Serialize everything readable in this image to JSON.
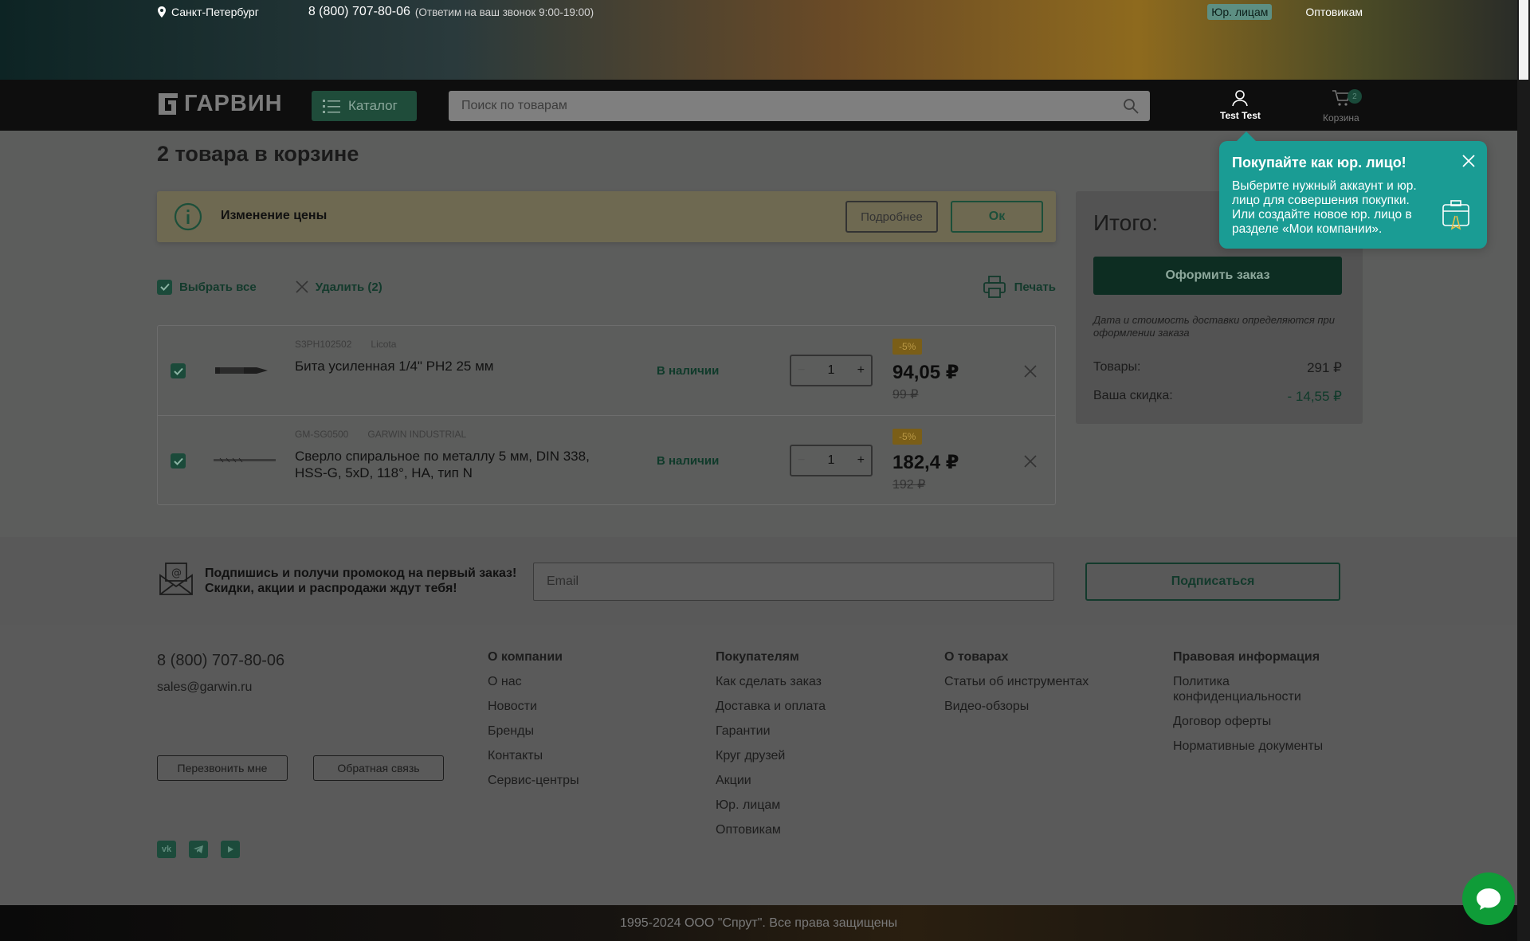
{
  "topbar": {
    "city": "Санкт-Петербург",
    "phone": "8 (800) 707-80-06",
    "phone_note": "(Ответим на ваш звонок 9:00-19:00)",
    "links": [
      "Юр. лицам",
      "Оптовикам"
    ]
  },
  "header": {
    "logo": "ГАРВИН",
    "catalog_label": "Каталог",
    "search_placeholder": "Поиск по товарам",
    "user_label": "Test Test",
    "cart_label": "Корзина",
    "cart_count": "2"
  },
  "cart": {
    "title": "2 товара в корзине",
    "notice": {
      "text": "Изменение цены",
      "more_label": "Подробнее",
      "ok_label": "Ок"
    },
    "select_all_label": "Выбрать все",
    "delete_label": "Удалить (2)",
    "print_label": "Печать",
    "items": [
      {
        "sku": "S3PH102502",
        "brand": "Licota",
        "name": "Бита усиленная 1/4\" PH2 25 мм",
        "stock": "В наличии",
        "qty": "1",
        "discount": "-5%",
        "price": "94,05 ₽",
        "old_price": "99 ₽"
      },
      {
        "sku": "GM-SG0500",
        "brand": "GARWIN INDUSTRIAL",
        "name": "Сверло спиральное по металлу 5 мм, DIN 338, HSS-G, 5xD, 118°, HA, тип N",
        "stock": "В наличии",
        "qty": "1",
        "discount": "-5%",
        "price": "182,4 ₽",
        "old_price": "192 ₽"
      }
    ]
  },
  "summary": {
    "title": "Итого:",
    "order_button": "Оформить заказ",
    "note": "Дата и стоимость доставки определяются при оформлении заказа",
    "goods_label": "Товары:",
    "goods_value": "291 ₽",
    "discount_label": "Ваша скидка:",
    "discount_value": "- 14,55 ₽"
  },
  "tooltip": {
    "title": "Покупайте как юр. лицо!",
    "text": "Выберите нужный аккаунт и юр. лицо для совершения покупки. Или создайте новое юр. лицо в разделе «Мои компании»."
  },
  "subscribe": {
    "line1": "Подпишись и получи промокод на первый заказ!",
    "line2": "Скидки, акции и распродажи ждут тебя!",
    "email_placeholder": "Email",
    "button": "Подписаться"
  },
  "footer": {
    "phone": "8 (800) 707-80-06",
    "email": "sales@garwin.ru",
    "callback_button": "Перезвонить мне",
    "feedback_button": "Обратная связь",
    "socials": [
      "vk",
      "telegram",
      "youtube"
    ],
    "columns": [
      {
        "title": "О компании",
        "links": [
          "О нас",
          "Новости",
          "Бренды",
          "Контакты",
          "Сервис-центры"
        ]
      },
      {
        "title": "Покупателям",
        "links": [
          "Как сделать заказ",
          "Доставка и оплата",
          "Гарантии",
          "Круг друзей",
          "Акции",
          "Юр. лицам",
          "Оптовикам"
        ]
      },
      {
        "title": "О товарах",
        "links": [
          "Статьи об инструментах",
          "Видео-обзоры"
        ]
      },
      {
        "title": "Правовая информация",
        "links": [
          "Политика конфиденциальности",
          "Договор оферты",
          "Нормативные документы"
        ]
      }
    ],
    "copyright": "1995-2024 ООО \"Спрут\". Все права защищены"
  },
  "colors": {
    "brand_green": "#1b4a3a",
    "tooltip_teal": "#1a9c94",
    "chat_green": "#0f9c38"
  }
}
